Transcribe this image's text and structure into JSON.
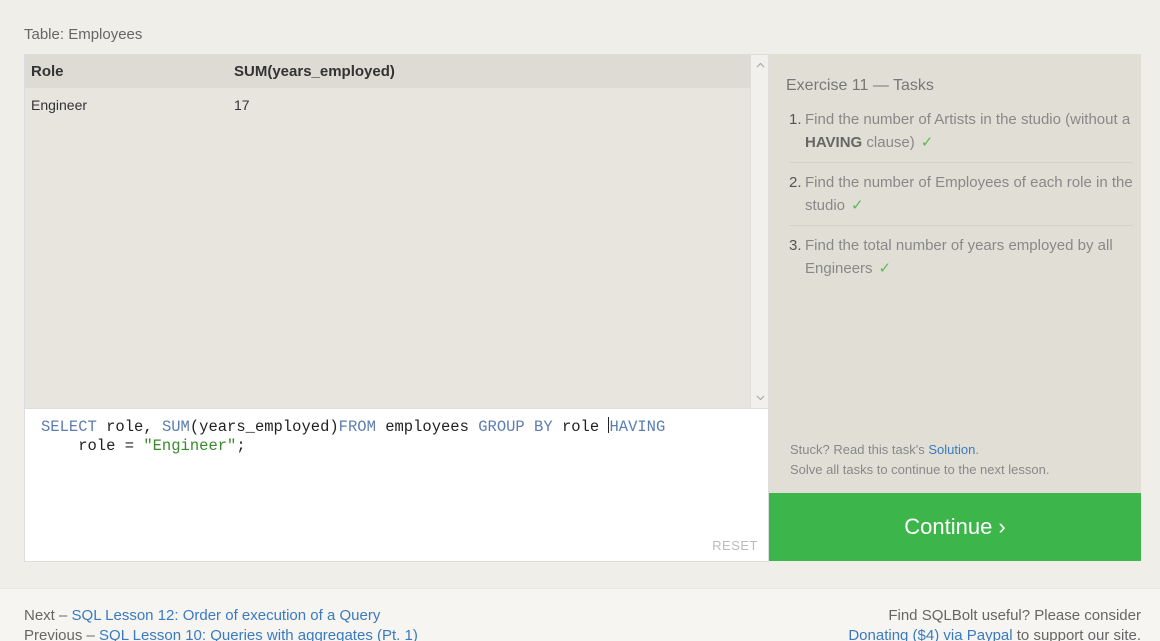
{
  "table": {
    "title": "Table: Employees",
    "headers": [
      "Role",
      "SUM(years_employed)"
    ],
    "rows": [
      [
        "Engineer",
        "17"
      ]
    ]
  },
  "editor": {
    "line1": {
      "kw1": "SELECT",
      "t1": " role, ",
      "fn1": "SUM",
      "t2": "(years_employed)",
      "kw2": "FROM",
      "t3": " employees ",
      "kw3": "GROUP BY",
      "t4": " role ",
      "kw4a": "H",
      "kw4b": "AVING"
    },
    "line2": {
      "t1": "    role = ",
      "str": "\"Engineer\"",
      "t2": ";"
    },
    "reset_label": "RESET"
  },
  "tasks": {
    "title": "Exercise 11 — Tasks",
    "items": [
      {
        "num": "1.",
        "pre": "Find the number of Artists in the studio (without a ",
        "bold": "HAVING",
        "post": " clause)",
        "check": "✓"
      },
      {
        "num": "2.",
        "pre": "Find the number of Employees of each role in the studio",
        "bold": "",
        "post": "",
        "check": "✓"
      },
      {
        "num": "3.",
        "pre": "Find the total number of years employed by all Engineers",
        "bold": "",
        "post": "",
        "check": "✓"
      }
    ],
    "stuck_pre": "Stuck? Read this task's ",
    "solution_link": "Solution",
    "stuck_post": ".",
    "solve_all": "Solve all tasks to continue to the next lesson."
  },
  "continue_label": "Continue ›",
  "footer": {
    "next_prefix": "Next – ",
    "next_link": "SQL Lesson 12: Order of execution of a Query",
    "prev_prefix": "Previous – ",
    "prev_link": "SQL Lesson 10: Queries with aggregates (Pt. 1)",
    "right_line1": "Find SQLBolt useful? Please consider",
    "donate_link": "Donating ($4) via Paypal",
    "right_line2_post": " to support our site."
  }
}
